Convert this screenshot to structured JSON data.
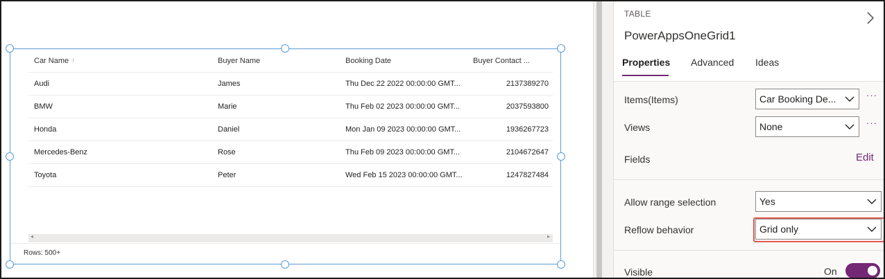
{
  "grid": {
    "columns": [
      "Car Name",
      "Buyer Name",
      "Booking Date",
      "Buyer Contact ..."
    ],
    "sort_indicator": "↑",
    "rows": [
      {
        "car": "Audi",
        "buyer": "James",
        "date": "Thu Dec 22 2022 00:00:00 GMT...",
        "contact": "2137389270"
      },
      {
        "car": "BMW",
        "buyer": "Marie",
        "date": "Thu Feb 02 2023 00:00:00 GMT...",
        "contact": "2037593800"
      },
      {
        "car": "Honda",
        "buyer": "Daniel",
        "date": "Mon Jan 09 2023 00:00:00 GMT...",
        "contact": "1936267723"
      },
      {
        "car": "Mercedes-Benz",
        "buyer": "Rose",
        "date": "Thu Feb 09 2023 00:00:00 GMT...",
        "contact": "2104672647"
      },
      {
        "car": "Toyota",
        "buyer": "Peter",
        "date": "Wed Feb 15 2023 00:00:00 GMT...",
        "contact": "1247827484"
      }
    ],
    "rows_count": "Rows: 500+"
  },
  "pane": {
    "kind": "TABLE",
    "control_name": "PowerAppsOneGrid1",
    "tabs": [
      "Properties",
      "Advanced",
      "Ideas"
    ],
    "items_label": "Items(Items)",
    "items_value": "Car Booking De...",
    "views_label": "Views",
    "views_value": "None",
    "more": "···",
    "fields_label": "Fields",
    "edit_link": "Edit",
    "range_label": "Allow range selection",
    "range_value": "Yes",
    "reflow_label": "Reflow behavior",
    "reflow_value": "Grid only",
    "visible_label": "Visible",
    "visible_value": "On"
  },
  "colors": {
    "accent": "#742774",
    "selection": "#5b9bd5",
    "highlight": "#e0584c"
  }
}
